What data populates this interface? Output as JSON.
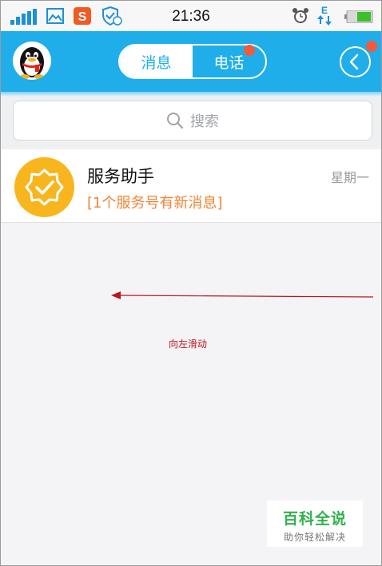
{
  "status_bar": {
    "time": "21:36",
    "icons": [
      "signal-icon",
      "gallery-icon",
      "sogou-s-icon",
      "shield-icon",
      "alarm-icon",
      "data-e-icon",
      "battery-icon"
    ]
  },
  "header": {
    "tabs": [
      {
        "label": "消息",
        "active": true
      },
      {
        "label": "电话",
        "active": false
      }
    ],
    "accent_color": "#1faee9",
    "badge_color": "#f25a3c"
  },
  "search": {
    "placeholder": "搜索"
  },
  "messages": [
    {
      "title": "服务助手",
      "subtitle": "[1个服务号有新消息]",
      "time": "星期一",
      "icon": "service-badge-icon"
    }
  ],
  "annotation": {
    "label": "向左滑动",
    "color": "#c0121b"
  },
  "watermark": {
    "title": "百科全说",
    "subtitle": "助你轻松解决"
  }
}
